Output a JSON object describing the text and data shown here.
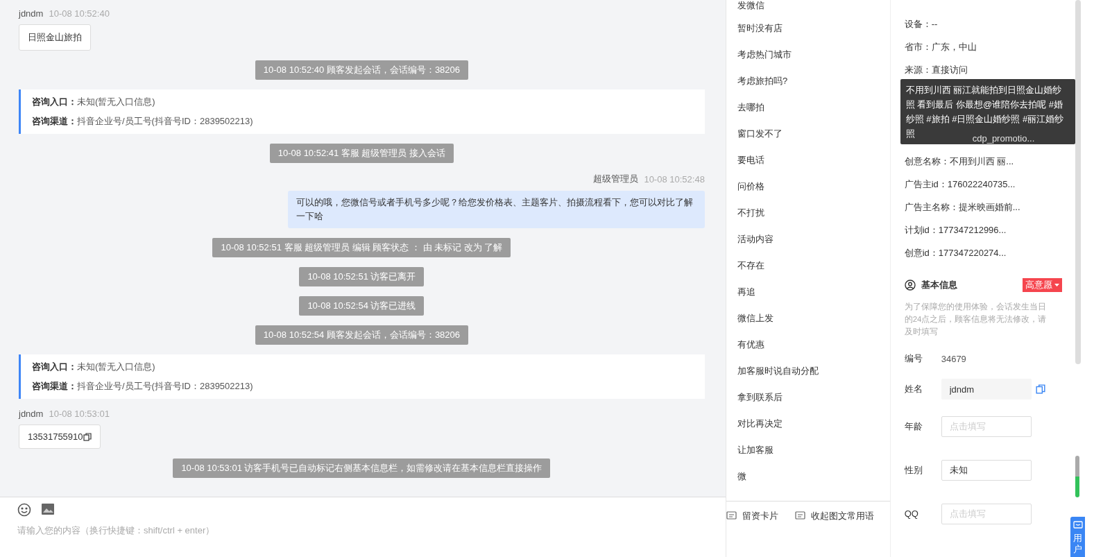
{
  "chat": {
    "messages": [
      {
        "kind": "visitor",
        "name": "jdndm",
        "time": "10-08 10:52:40",
        "text": "日照金山旅拍",
        "copy": false
      },
      {
        "kind": "system",
        "text": "10-08 10:52:40 顾客发起会话，会话编号：38206"
      },
      {
        "kind": "info",
        "rows": [
          {
            "label": "咨询入口：",
            "value": "未知(暂无入口信息)"
          },
          {
            "label": "咨询渠道：",
            "value": "抖音企业号/员工号(抖音号ID：2839502213)"
          }
        ]
      },
      {
        "kind": "system",
        "text": "10-08 10:52:41 客服 超级管理员 接入会话"
      },
      {
        "kind": "agent",
        "name": "超级管理员",
        "time": "10-08 10:52:48",
        "text": "可以的哦，您微信号或者手机号多少呢？给您发价格表、主题客片、拍摄流程看下，您可以对比了解一下哈"
      },
      {
        "kind": "system",
        "text": "10-08 10:52:51 客服 超级管理员 编辑 顾客状态 ： 由 未标记 改为 了解"
      },
      {
        "kind": "system",
        "text": "10-08 10:52:51 访客已离开"
      },
      {
        "kind": "system",
        "text": "10-08 10:52:54 访客已进线"
      },
      {
        "kind": "system",
        "text": "10-08 10:52:54 顾客发起会话，会话编号：38206"
      },
      {
        "kind": "info",
        "rows": [
          {
            "label": "咨询入口：",
            "value": "未知(暂无入口信息)"
          },
          {
            "label": "咨询渠道：",
            "value": "抖音企业号/员工号(抖音号ID：2839502213)"
          }
        ]
      },
      {
        "kind": "visitor",
        "name": "jdndm",
        "time": "10-08 10:53:01",
        "text": "13531755910",
        "copy": true
      },
      {
        "kind": "system",
        "text": "10-08 10:53:01 访客手机号已自动标记右侧基本信息栏，如需修改请在基本信息栏直接操作"
      }
    ],
    "input": {
      "placeholder": "请输入您的内容（换行快捷键：shift/ctrl + enter）"
    }
  },
  "phrases": {
    "items": [
      "发微信",
      "暂时没有店",
      "考虑热门城市",
      "考虑旅拍吗?",
      "去哪拍",
      "窗口发不了",
      "要电话",
      "问价格",
      "不打扰",
      "活动内容",
      "不存在",
      "再追",
      "微信上发",
      "有优惠",
      "加客服时说自动分配",
      "拿到联系后",
      "对比再决定",
      "让加客服",
      "微"
    ],
    "buttons": [
      "留资卡片",
      "收起图文常用语"
    ]
  },
  "source_info": {
    "rows": [
      {
        "text": "设备：--"
      },
      {
        "text": "省市：广东，中山"
      },
      {
        "text": "来源：直接访问"
      }
    ],
    "covered_value": "cdp_promotio...",
    "rows_after": [
      {
        "text": "创意名称：不用到川西 丽..."
      },
      {
        "text": "广告主id：176022240735..."
      },
      {
        "text": "广告主名称：提米映画婚前..."
      },
      {
        "text": "计划id：177347212996..."
      },
      {
        "text": "创意id：177347220274..."
      }
    ],
    "tooltip": "不用到川西 丽江就能拍到日照金山婚纱照 看到最后 你最想@谁陪你去拍呢 #婚纱照 #旅拍 #日照金山婚纱照 #丽江婚纱照"
  },
  "basic_info": {
    "title": "基本信息",
    "tag": "高意愿",
    "notice": "为了保障您的使用体验，会话发生当日的24点之后，顾客信息将无法修改，请及时填写",
    "fields": [
      {
        "kind": "static",
        "label": "编号",
        "value": "34679"
      },
      {
        "kind": "filled",
        "label": "姓名",
        "value": "jdndm"
      },
      {
        "kind": "input",
        "label": "年龄",
        "placeholder": "点击填写"
      },
      {
        "kind": "input",
        "label": "性别",
        "value": "未知"
      },
      {
        "kind": "input",
        "label": "QQ",
        "placeholder": "点击填写"
      }
    ]
  },
  "side_button": {
    "label": "用户"
  }
}
